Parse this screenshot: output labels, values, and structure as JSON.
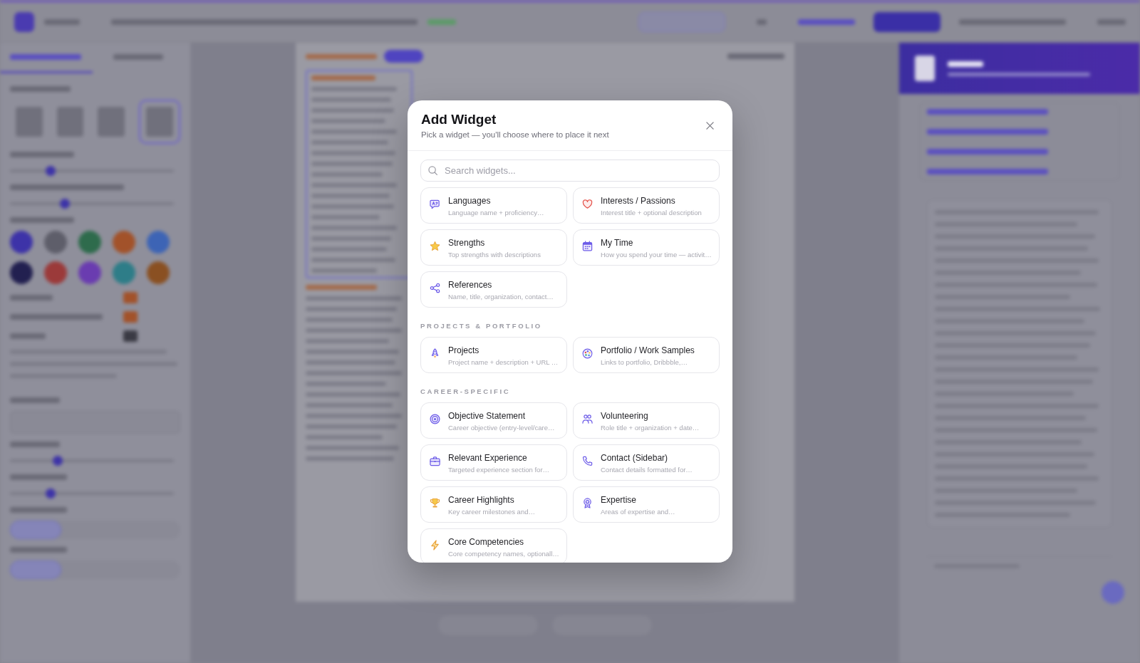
{
  "dialog": {
    "title": "Add Widget",
    "subtitle": "Pick a widget — you'll choose where to place it next",
    "search": {
      "placeholder": "Search widgets..."
    },
    "sections": [
      {
        "items": [
          {
            "title": "Languages",
            "description": "Language name + proficiency…"
          },
          {
            "title": "Interests / Passions",
            "description": "Interest title + optional description"
          },
          {
            "title": "Strengths",
            "description": "Top strengths with descriptions"
          },
          {
            "title": "My Time",
            "description": "How you spend your time — activit…"
          },
          {
            "title": "References",
            "description": "Name, title, organization, contact…"
          }
        ]
      },
      {
        "heading": "PROJECTS & PORTFOLIO",
        "items": [
          {
            "title": "Projects",
            "description": "Project name + description + URL …"
          },
          {
            "title": "Portfolio / Work Samples",
            "description": "Links to portfolio, Dribbble,…"
          }
        ]
      },
      {
        "heading": "CAREER-SPECIFIC",
        "items": [
          {
            "title": "Objective Statement",
            "description": "Career objective (entry-level/care…"
          },
          {
            "title": "Volunteering",
            "description": "Role title + organization + date…"
          },
          {
            "title": "Relevant Experience",
            "description": "Targeted experience section for…"
          },
          {
            "title": "Contact (Sidebar)",
            "description": "Contact details formatted for…"
          },
          {
            "title": "Career Highlights",
            "description": "Key career milestones and…"
          },
          {
            "title": "Expertise",
            "description": "Areas of expertise and…"
          },
          {
            "title": "Core Competencies",
            "description": "Core competency names, optionall…"
          }
        ]
      }
    ]
  }
}
